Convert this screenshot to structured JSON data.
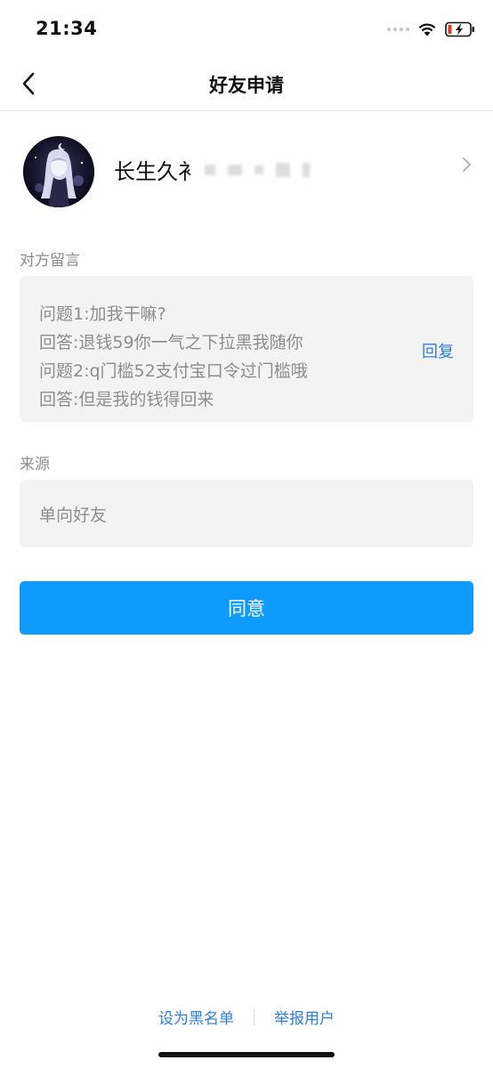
{
  "status_bar": {
    "time": "21:34",
    "battery_color": "#e5352b"
  },
  "nav": {
    "title": "好友申请",
    "back_icon": "chevron-left-icon"
  },
  "profile": {
    "name": "长生久衤",
    "chevron_icon": "chevron-right-icon"
  },
  "message_section": {
    "label": "对方留言",
    "lines": [
      "问题1:加我干嘛?",
      "回答:退钱59你一气之下拉黑我随你",
      "问题2:q门槛52支付宝口令过门槛哦",
      "回答:但是我的钱得回来"
    ],
    "reply_label": "回复"
  },
  "source_section": {
    "label": "来源",
    "value": "单向好友"
  },
  "agree_button": {
    "label": "同意",
    "color": "#0f9bfb"
  },
  "footer": {
    "blacklist_label": "设为黑名单",
    "report_label": "举报用户"
  },
  "colors": {
    "link": "#2f7fd4",
    "muted_text": "#8d8d8d",
    "box_bg": "#f3f3f3"
  }
}
